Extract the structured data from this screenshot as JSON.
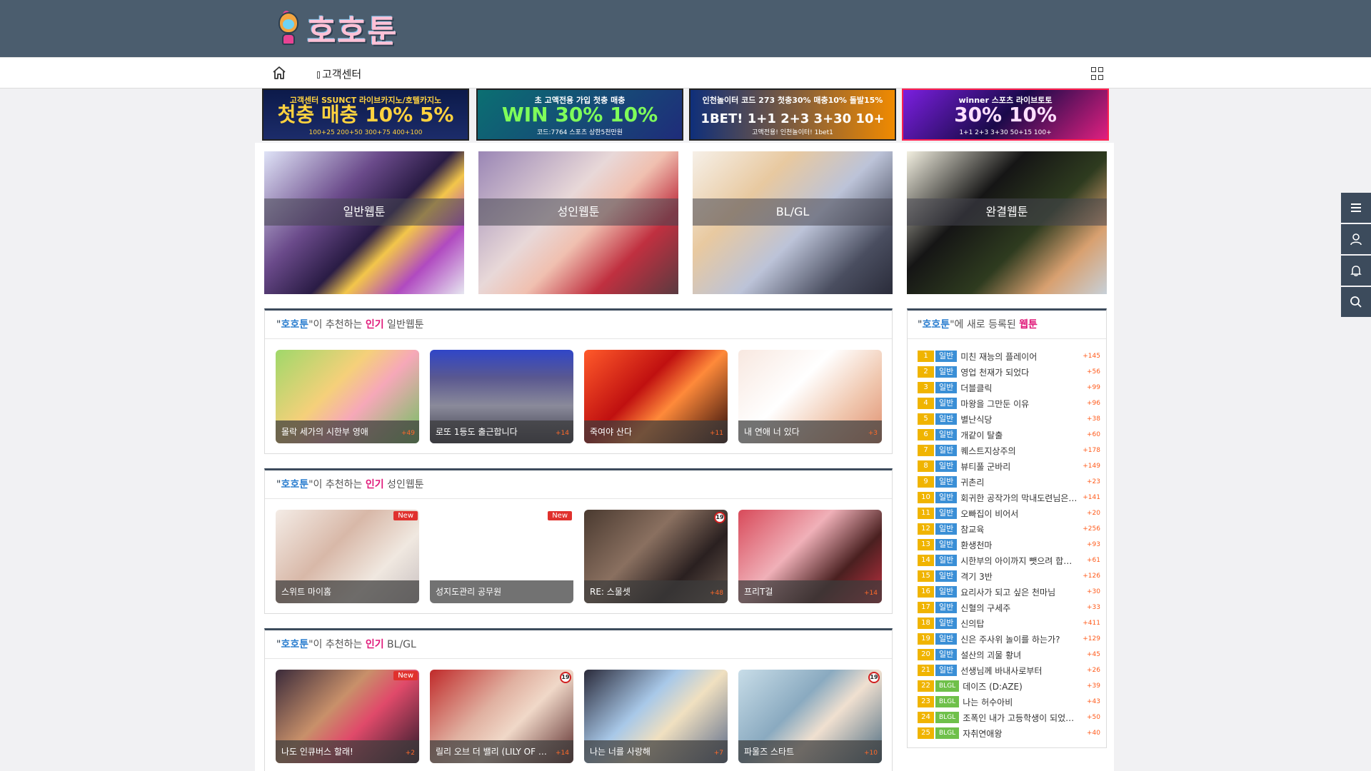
{
  "header": {
    "logo_text": "호호툰",
    "right_icon": ""
  },
  "nav": {
    "home_icon": "home-icon",
    "customer_center": "고객센터",
    "menu_icon": "grid-icon"
  },
  "banners": [
    {
      "line1": "고객센터 SSUNCT 라이브카지노/호텔카지노",
      "big": "첫충 매충 10% 5%",
      "line3": "100+25 200+50 300+75 400+100"
    },
    {
      "line1": "초 고액전용 가입 첫충 매충",
      "big": "WIN 30% 10%",
      "line3": "코드:7764 스포츠 상한5천만원"
    },
    {
      "line1": "인천놀이터 코드 273 첫충30% 매충10% 돌발15%",
      "big": "1BET! 1+1 2+3 3+30 10+",
      "line3": "고액전용! 인천놀이터! 1bet1"
    },
    {
      "line1": "winner 스포츠 라이브토토",
      "big": "30% 10%",
      "line3": "1+1 2+3 3+30 50+15 100+"
    }
  ],
  "categories": [
    {
      "label": "일반웹툰"
    },
    {
      "label": "성인웹툰"
    },
    {
      "label": "BL/GL"
    },
    {
      "label": "완결웹툰"
    }
  ],
  "sections": [
    {
      "quote_open": "\"",
      "brand": "호호툰",
      "mid": "\"이 추천하는 ",
      "pop": "인기",
      "kind": " 일반웹툰",
      "cards": [
        {
          "title": "몰락 세가의 시한부 영애",
          "count": "+49",
          "badge": ""
        },
        {
          "title": "로또 1등도 출근합니다",
          "count": "+14",
          "badge": ""
        },
        {
          "title": "죽여야 산다",
          "count": "+11",
          "badge": ""
        },
        {
          "title": "내 연애 너 있다",
          "count": "+3",
          "badge": ""
        }
      ]
    },
    {
      "quote_open": "\"",
      "brand": "호호툰",
      "mid": "\"이 추천하는 ",
      "pop": "인기",
      "kind": " 성인웹툰",
      "cards": [
        {
          "title": "스위트 마이홈",
          "count": "",
          "badge": "New"
        },
        {
          "title": "성지도관리 공무원",
          "count": "",
          "badge": "New"
        },
        {
          "title": "RE: 스물셋",
          "count": "+48",
          "badge": "19"
        },
        {
          "title": "프리T걸",
          "count": "+14",
          "badge": ""
        }
      ]
    },
    {
      "quote_open": "\"",
      "brand": "호호툰",
      "mid": "\"이 추천하는 ",
      "pop": "인기",
      "kind": " BL/GL",
      "cards": [
        {
          "title": "나도 인큐버스 할래!",
          "count": "+2",
          "badge": "New"
        },
        {
          "title": "릴리 오브 더 밸리 (LILY OF THE VALLEY)",
          "count": "+14",
          "badge": "19"
        },
        {
          "title": "나는 너를 사랑해",
          "count": "+7",
          "badge": ""
        },
        {
          "title": "파울즈 스타트",
          "count": "+10",
          "badge": "19"
        }
      ]
    }
  ],
  "new_list": {
    "quote_open": "\"",
    "brand": "호호툰",
    "mid": "\"에 새로 등록된 ",
    "pop": "웹툰",
    "items": [
      {
        "rank": "1",
        "tag": "일반",
        "title": "미친 재능의 플레이어",
        "count": "+145"
      },
      {
        "rank": "2",
        "tag": "일반",
        "title": "영업 천재가 되었다",
        "count": "+56"
      },
      {
        "rank": "3",
        "tag": "일반",
        "title": "더블클릭",
        "count": "+99"
      },
      {
        "rank": "4",
        "tag": "일반",
        "title": "마왕을 그만둔 이유",
        "count": "+96"
      },
      {
        "rank": "5",
        "tag": "일반",
        "title": "별난식당",
        "count": "+38"
      },
      {
        "rank": "6",
        "tag": "일반",
        "title": "개같이 탈출",
        "count": "+60"
      },
      {
        "rank": "7",
        "tag": "일반",
        "title": "퀘스트지상주의",
        "count": "+178"
      },
      {
        "rank": "8",
        "tag": "일반",
        "title": "뷰티풀 군바리",
        "count": "+149"
      },
      {
        "rank": "9",
        "tag": "일반",
        "title": "귀촌리",
        "count": "+23"
      },
      {
        "rank": "10",
        "tag": "일반",
        "title": "회귀한 공작가의 막내도련님은 암살자",
        "count": "+141"
      },
      {
        "rank": "11",
        "tag": "일반",
        "title": "오빠집이 비어서",
        "count": "+20"
      },
      {
        "rank": "12",
        "tag": "일반",
        "title": "참교육",
        "count": "+256"
      },
      {
        "rank": "13",
        "tag": "일반",
        "title": "환생천마",
        "count": "+93"
      },
      {
        "rank": "14",
        "tag": "일반",
        "title": "시한부의 아이까지 뺏으려 합니다",
        "count": "+61"
      },
      {
        "rank": "15",
        "tag": "일반",
        "title": "격기 3반",
        "count": "+126"
      },
      {
        "rank": "16",
        "tag": "일반",
        "title": "요리사가 되고 싶은 천마님",
        "count": "+30"
      },
      {
        "rank": "17",
        "tag": "일반",
        "title": "신혈의 구세주",
        "count": "+33"
      },
      {
        "rank": "18",
        "tag": "일반",
        "title": "신의탑",
        "count": "+411"
      },
      {
        "rank": "19",
        "tag": "일반",
        "title": "신은 주사위 놀이를 하는가?",
        "count": "+129"
      },
      {
        "rank": "20",
        "tag": "일반",
        "title": "설산의 괴물 황녀",
        "count": "+45"
      },
      {
        "rank": "21",
        "tag": "일반",
        "title": "선생님께 바내사로부터",
        "count": "+26"
      },
      {
        "rank": "22",
        "tag": "BLGL",
        "title": "데이즈 (D:AZE)",
        "count": "+39"
      },
      {
        "rank": "23",
        "tag": "BLGL",
        "title": "나는 허수아비",
        "count": "+43"
      },
      {
        "rank": "24",
        "tag": "BLGL",
        "title": "조폭인 내가 고등학생이 되었습니다",
        "count": "+50"
      },
      {
        "rank": "25",
        "tag": "BLGL",
        "title": "자취연애왕",
        "count": "+40"
      }
    ]
  },
  "side_menu": [
    "menu-icon",
    "user-icon",
    "bell-icon",
    "search-icon"
  ],
  "colors": {
    "header_bg": "#4b5d6e",
    "brand_blue": "#2d7fd0",
    "accent_pink": "#e01a7a",
    "rank_bg": "#f0b400",
    "tag_general": "#3a8fd6",
    "tag_blgl": "#6fc04a"
  }
}
